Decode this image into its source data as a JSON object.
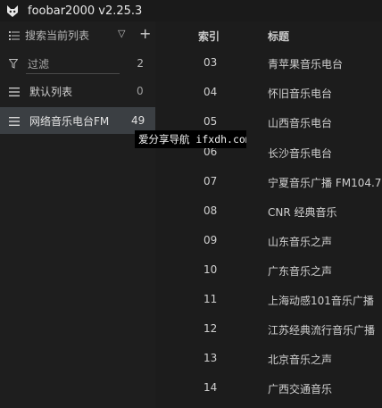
{
  "window": {
    "title": "foobar2000 v2.25.3",
    "icon": "foobar-logo-icon"
  },
  "sidebar": {
    "search": {
      "label": "搜索当前列表",
      "dropdown_icon": "chevron-down-icon",
      "add_icon": "plus-icon"
    },
    "filter": {
      "placeholder": "过滤",
      "count": "2"
    },
    "playlists": [
      {
        "label": "默认列表",
        "count": "0",
        "selected": false
      },
      {
        "label": "网络音乐电台FM",
        "count": "49",
        "selected": true
      }
    ]
  },
  "table": {
    "columns": [
      "索引",
      "标题"
    ],
    "rows": [
      {
        "index": "03",
        "title": "青苹果音乐电台"
      },
      {
        "index": "04",
        "title": "怀旧音乐电台"
      },
      {
        "index": "05",
        "title": "山西音乐电台"
      },
      {
        "index": "06",
        "title": "长沙音乐电台"
      },
      {
        "index": "07",
        "title": "宁夏音乐广播 FM104.7"
      },
      {
        "index": "08",
        "title": "CNR 经典音乐"
      },
      {
        "index": "09",
        "title": "山东音乐之声"
      },
      {
        "index": "10",
        "title": "广东音乐之声"
      },
      {
        "index": "11",
        "title": "上海动感101音乐广播"
      },
      {
        "index": "12",
        "title": "江苏经典流行音乐广播"
      },
      {
        "index": "13",
        "title": "北京音乐之声"
      },
      {
        "index": "14",
        "title": "广西交通音乐"
      }
    ]
  },
  "watermark": {
    "text": "爱分享导航 ifxdh.com"
  },
  "colors": {
    "background": "#1c1c1c",
    "selected_row": "#3b3f43",
    "text": "#d0d0d0"
  }
}
